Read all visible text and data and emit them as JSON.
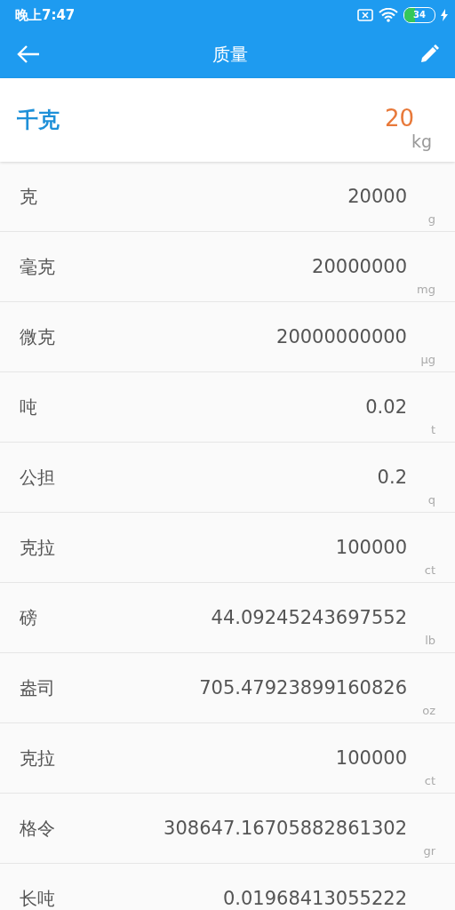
{
  "status_bar": {
    "time": "晚上7:47",
    "battery": "34"
  },
  "toolbar": {
    "title": "质量"
  },
  "base": {
    "name": "千克",
    "value": "20",
    "unit": "kg"
  },
  "units": [
    {
      "name": "克",
      "value": "20000",
      "unit": "g"
    },
    {
      "name": "毫克",
      "value": "20000000",
      "unit": "mg"
    },
    {
      "name": "微克",
      "value": "20000000000",
      "unit": "μg"
    },
    {
      "name": "吨",
      "value": "0.02",
      "unit": "t"
    },
    {
      "name": "公担",
      "value": "0.2",
      "unit": "q"
    },
    {
      "name": "克拉",
      "value": "100000",
      "unit": "ct"
    },
    {
      "name": "磅",
      "value": "44.09245243697552",
      "unit": "lb"
    },
    {
      "name": "盎司",
      "value": "705.47923899160826",
      "unit": "oz"
    },
    {
      "name": "克拉",
      "value": "100000",
      "unit": "ct"
    },
    {
      "name": "格令",
      "value": "308647.16705882861302",
      "unit": "gr"
    },
    {
      "name": "长吨",
      "value": "0.01968413055222"
    }
  ]
}
